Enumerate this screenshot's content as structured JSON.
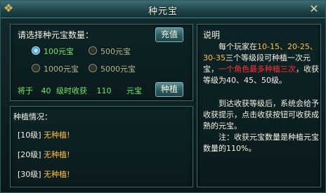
{
  "window": {
    "title": "种元宝"
  },
  "select_panel": {
    "heading": "请选择种元宝数量：",
    "recharge_label": "充值",
    "options": [
      {
        "label": "100元宝",
        "selected": true
      },
      {
        "label": "500元宝",
        "selected": false
      },
      {
        "label": "1000元宝",
        "selected": false
      },
      {
        "label": "5000元宝",
        "selected": false
      }
    ],
    "harvest_prefix": "将于",
    "harvest_level": "40",
    "harvest_mid": "级时收获",
    "harvest_amount": "110",
    "harvest_unit": "元宝",
    "plant_label": "种植"
  },
  "status_panel": {
    "heading": "种植情况：",
    "rows": [
      {
        "level": "[10级]",
        "status": "无种植!"
      },
      {
        "level": "[20级]",
        "status": "无种植!"
      },
      {
        "level": "[30级]",
        "status": "无种植!"
      }
    ]
  },
  "explain_panel": {
    "heading": "说明",
    "p1_a": "每个玩家在",
    "p1_b": "10-15、20-25、30-35",
    "p1_c": "三个等级段可种植一次元宝，",
    "p1_d": "一个角色最多种植三次",
    "p1_e": "，收获等级为40、45、50级。",
    "p2": "到达收获等级后，系统会给予收获提示，点击收获按钮可收获成熟的元宝。",
    "note": "注：收获元宝数量是种植元宝数量的110%。"
  },
  "colors": {
    "option_selected": "#70e86b",
    "option_unselected": "#b6b58a",
    "status_text": "#ffc03a",
    "warning": "#ff3333"
  }
}
